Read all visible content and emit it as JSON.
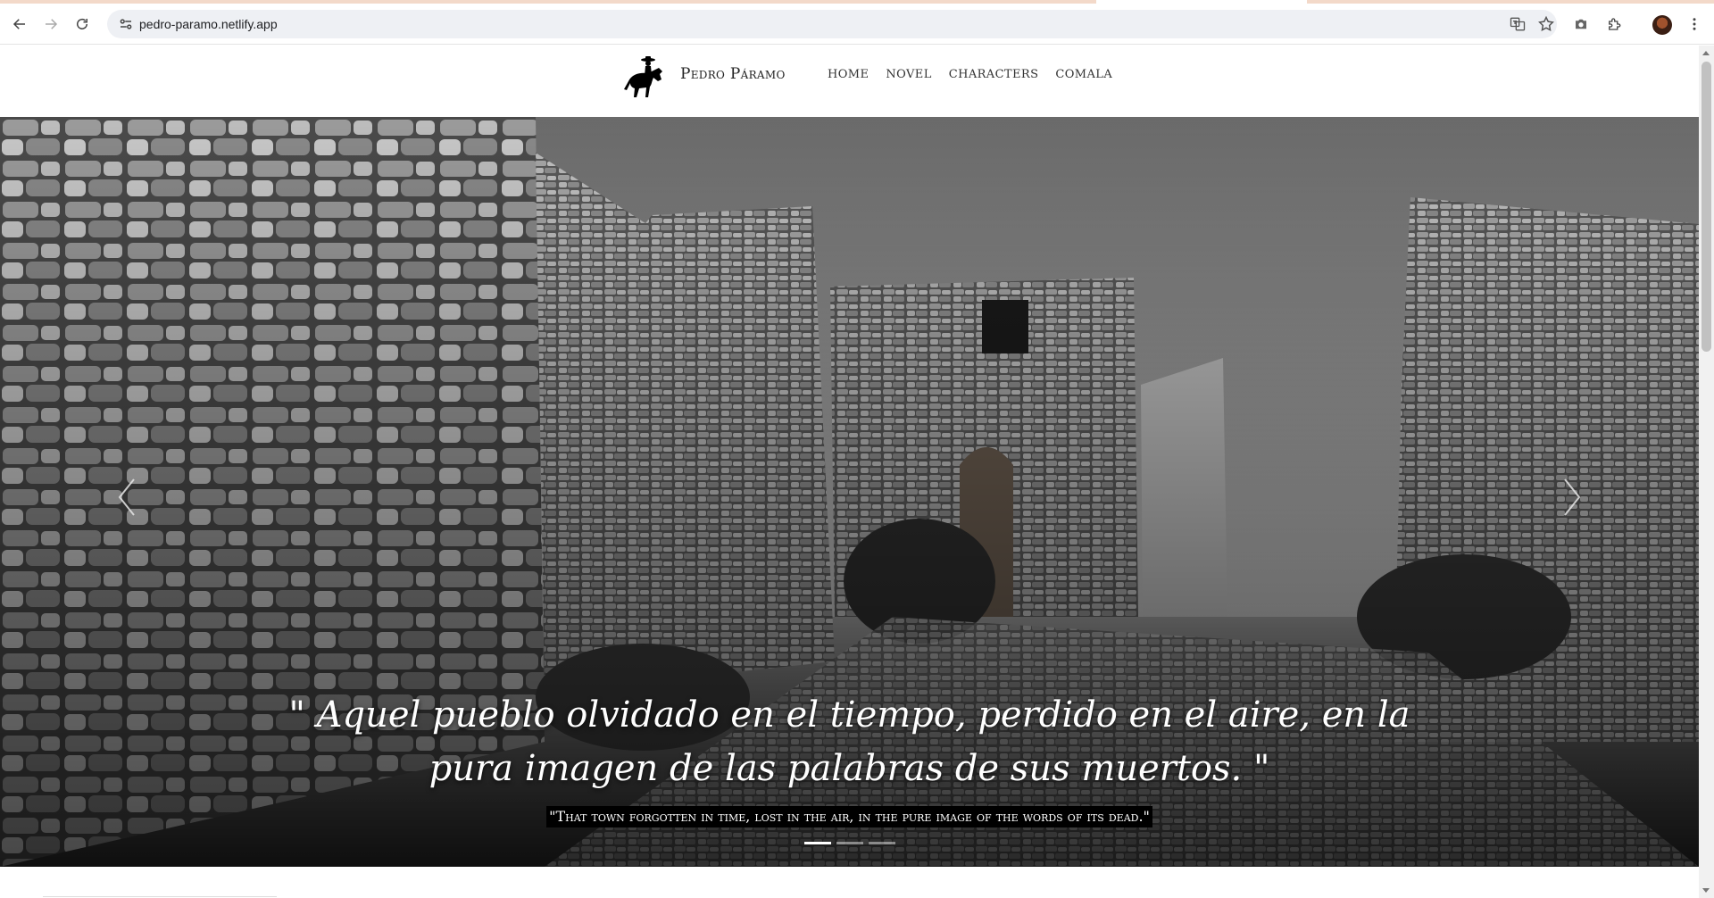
{
  "browser": {
    "url": "pedro-paramo.netlify.app"
  },
  "site": {
    "brand": "Pedro Páramo",
    "nav": [
      "HOME",
      "NOVEL",
      "CHARACTERS",
      "COMALA"
    ]
  },
  "hero": {
    "quote_es": "\" Aquel pueblo olvidado en el tiempo, perdido en el aire, en la pura imagen de las palabras de sus muertos. \"",
    "quote_en": "\"That town forgotten in time, lost in the air, in the pure image of the words of its dead.\"",
    "slides": 3,
    "active_slide": 1
  }
}
